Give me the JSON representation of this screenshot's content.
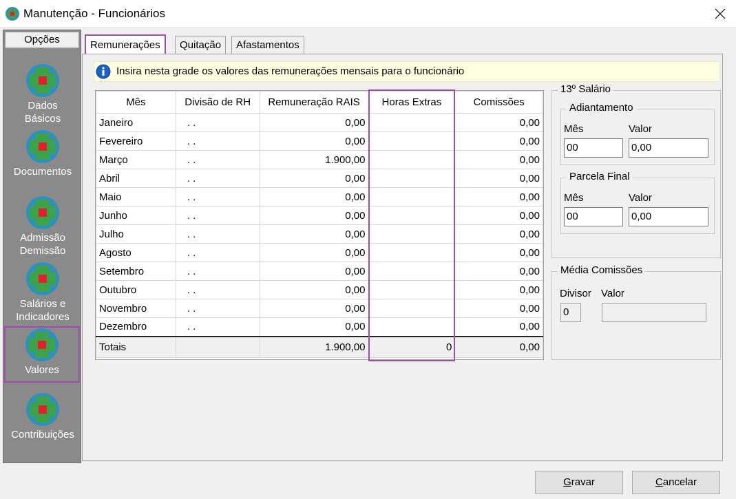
{
  "window": {
    "title": "Manutenção - Funcionários"
  },
  "sidebar": {
    "header": "Opções",
    "items": [
      {
        "label_line1": "Dados",
        "label_line2": "Básicos"
      },
      {
        "label_line1": "Documentos",
        "label_line2": ""
      },
      {
        "label_line1": "Admissão",
        "label_line2": "Demissão"
      },
      {
        "label_line1": "Salários e",
        "label_line2": "Indicadores"
      },
      {
        "label_line1": "Valores",
        "label_line2": ""
      },
      {
        "label_line1": "Contribuições",
        "label_line2": ""
      }
    ]
  },
  "tabs": [
    "Remunerações",
    "Quitação",
    "Afastamentos"
  ],
  "info": {
    "text": "Insira nesta grade os valores das remunerações mensais para o funcionário"
  },
  "grid": {
    "columns": [
      "Mês",
      "Divisão de RH",
      "Remuneração RAIS",
      "Horas Extras",
      "Comissões"
    ],
    "rows": [
      {
        "mes": "Janeiro",
        "divisao": ". .",
        "rais": "0,00",
        "horas": "",
        "comissoes": "0,00"
      },
      {
        "mes": "Fevereiro",
        "divisao": ". .",
        "rais": "0,00",
        "horas": "",
        "comissoes": "0,00"
      },
      {
        "mes": "Março",
        "divisao": ". .",
        "rais": "1.900,00",
        "horas": "",
        "comissoes": "0,00"
      },
      {
        "mes": "Abril",
        "divisao": ". .",
        "rais": "0,00",
        "horas": "",
        "comissoes": "0,00"
      },
      {
        "mes": "Maio",
        "divisao": ". .",
        "rais": "0,00",
        "horas": "",
        "comissoes": "0,00"
      },
      {
        "mes": "Junho",
        "divisao": ". .",
        "rais": "0,00",
        "horas": "",
        "comissoes": "0,00"
      },
      {
        "mes": "Julho",
        "divisao": ". .",
        "rais": "0,00",
        "horas": "",
        "comissoes": "0,00"
      },
      {
        "mes": "Agosto",
        "divisao": ". .",
        "rais": "0,00",
        "horas": "",
        "comissoes": "0,00"
      },
      {
        "mes": "Setembro",
        "divisao": ". .",
        "rais": "0,00",
        "horas": "",
        "comissoes": "0,00"
      },
      {
        "mes": "Outubro",
        "divisao": ". .",
        "rais": "0,00",
        "horas": "",
        "comissoes": "0,00"
      },
      {
        "mes": "Novembro",
        "divisao": ". .",
        "rais": "0,00",
        "horas": "",
        "comissoes": "0,00"
      },
      {
        "mes": "Dezembro",
        "divisao": ". .",
        "rais": "0,00",
        "horas": "",
        "comissoes": "0,00"
      }
    ],
    "totals": {
      "mes": "Totais",
      "divisao": "",
      "rais": "1.900,00",
      "horas": "0",
      "comissoes": "0,00"
    }
  },
  "decimo": {
    "title": "13º Salário",
    "adiantamento": {
      "title": "Adiantamento",
      "mes_label": "Mês",
      "valor_label": "Valor",
      "mes": "00",
      "valor": "0,00"
    },
    "parcela_final": {
      "title": "Parcela Final",
      "mes_label": "Mês",
      "valor_label": "Valor",
      "mes": "00",
      "valor": "0,00"
    }
  },
  "media_comissoes": {
    "title": "Média Comissões",
    "divisor_label": "Divisor",
    "valor_label": "Valor",
    "divisor": "0",
    "valor": ""
  },
  "buttons": {
    "gravar_accel": "G",
    "gravar_rest": "ravar",
    "cancelar_accel": "C",
    "cancelar_rest": "ancelar"
  },
  "colors": {
    "highlight": "#9b4fa8",
    "info_bg": "#ffffe1",
    "sidebar_bg": "#8a8a8a"
  }
}
